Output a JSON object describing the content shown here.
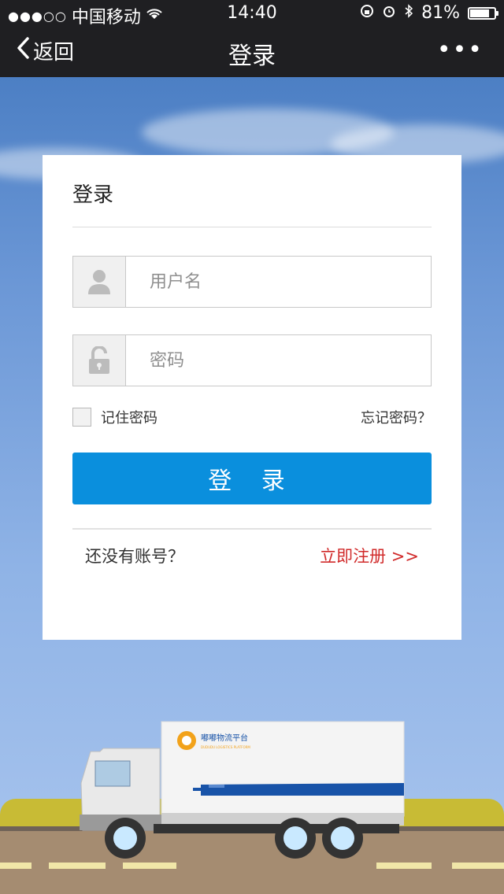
{
  "status_bar": {
    "carrier": "中国移动",
    "time": "14:40",
    "battery": "81%",
    "battery_level": 0.81
  },
  "nav": {
    "back_label": "返回",
    "title": "登录",
    "more_label": "•••"
  },
  "card": {
    "title": "登录",
    "username_placeholder": "用户名",
    "password_placeholder": "密码",
    "remember_label": "记住密码",
    "forgot_label": "忘记密码？",
    "login_button": "登 录",
    "no_account": "还没有账号？",
    "register_link": "立即注册 >>"
  },
  "truck": {
    "logo_text": "嘟嘟物流平台",
    "logo_subtext": "DUDUDU LOGISTICS PLATFORM"
  },
  "colors": {
    "primary": "#0a8fdd",
    "link_red": "#d12b2b",
    "bar_bg": "#1f1f22"
  }
}
